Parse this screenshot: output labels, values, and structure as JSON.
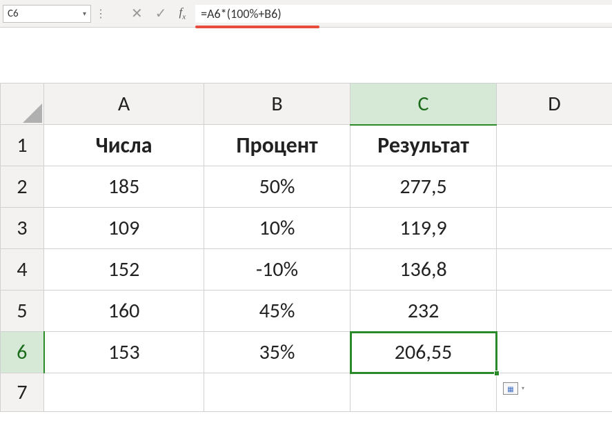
{
  "nameBox": "C6",
  "formula": "=A6*(100%+B6)",
  "fxLabel": "fx",
  "columnHeaders": [
    "A",
    "B",
    "C",
    "D"
  ],
  "activeColumn": "C",
  "activeRow": "6",
  "rowNumbers": [
    "1",
    "2",
    "3",
    "4",
    "5",
    "6",
    "7"
  ],
  "headers": {
    "A": "Числа",
    "B": "Процент",
    "C": "Результат"
  },
  "rows": [
    {
      "A": "185",
      "B": "50%",
      "C": "277,5"
    },
    {
      "A": "109",
      "B": "10%",
      "C": "119,9"
    },
    {
      "A": "152",
      "B": "-10%",
      "C": "136,8"
    },
    {
      "A": "160",
      "B": "45%",
      "C": "232"
    },
    {
      "A": "153",
      "B": "35%",
      "C": "206,55"
    }
  ],
  "chart_data": {
    "type": "table",
    "title": "",
    "columns": [
      "Числа",
      "Процент",
      "Результат"
    ],
    "data": [
      [
        185,
        "50%",
        "277,5"
      ],
      [
        109,
        "10%",
        "119,9"
      ],
      [
        152,
        "-10%",
        "136,8"
      ],
      [
        160,
        "45%",
        "232"
      ],
      [
        153,
        "35%",
        "206,55"
      ]
    ]
  }
}
